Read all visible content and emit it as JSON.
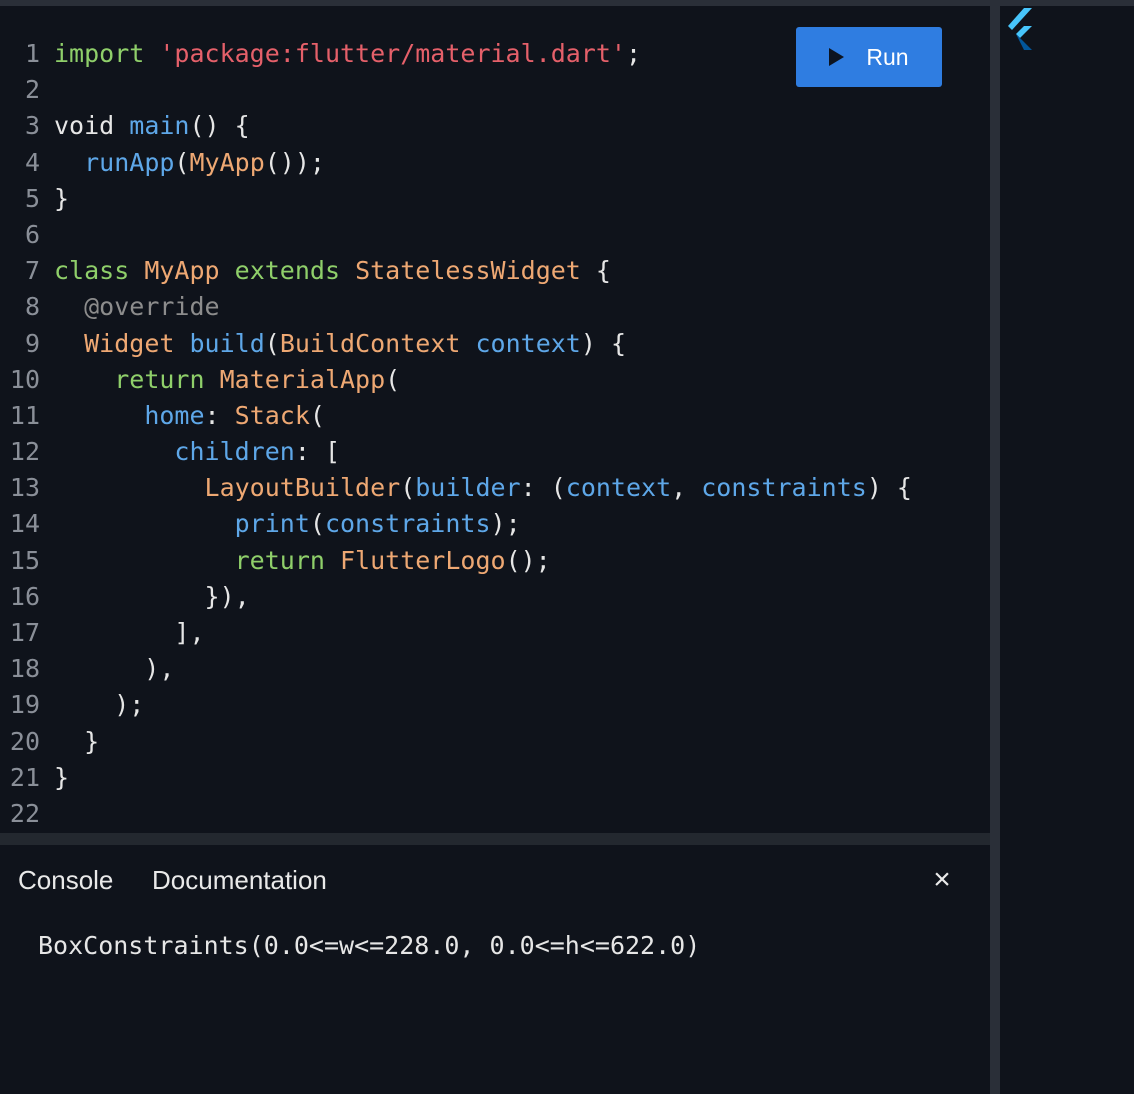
{
  "toolbar": {
    "run_label": "Run"
  },
  "icons": {
    "run": "play-icon",
    "close": "close-icon",
    "brand": "flutter-logo-icon"
  },
  "colors": {
    "keyword": "#8fcf6a",
    "string": "#e5606a",
    "function": "#5ea7e8",
    "type": "#eea873",
    "run_button": "#2f7de1",
    "background": "#0f131b"
  },
  "editor": {
    "lines": [
      [
        {
          "t": "import",
          "c": "kw"
        },
        {
          "t": " ",
          "c": "plain"
        },
        {
          "t": "'package:flutter/material.dart'",
          "c": "str"
        },
        {
          "t": ";",
          "c": "punc"
        }
      ],
      [],
      [
        {
          "t": "void ",
          "c": "plain"
        },
        {
          "t": "main",
          "c": "fn"
        },
        {
          "t": "() {",
          "c": "punc"
        }
      ],
      [
        {
          "t": "  ",
          "c": "plain"
        },
        {
          "t": "runApp",
          "c": "fn"
        },
        {
          "t": "(",
          "c": "punc"
        },
        {
          "t": "MyApp",
          "c": "type"
        },
        {
          "t": "());",
          "c": "punc"
        }
      ],
      [
        {
          "t": "}",
          "c": "punc"
        }
      ],
      [],
      [
        {
          "t": "class",
          "c": "kw"
        },
        {
          "t": " ",
          "c": "plain"
        },
        {
          "t": "MyApp",
          "c": "type"
        },
        {
          "t": " ",
          "c": "plain"
        },
        {
          "t": "extends",
          "c": "kw"
        },
        {
          "t": " ",
          "c": "plain"
        },
        {
          "t": "StatelessWidget",
          "c": "type"
        },
        {
          "t": " {",
          "c": "punc"
        }
      ],
      [
        {
          "t": "  ",
          "c": "plain"
        },
        {
          "t": "@override",
          "c": "ann"
        }
      ],
      [
        {
          "t": "  ",
          "c": "plain"
        },
        {
          "t": "Widget",
          "c": "type"
        },
        {
          "t": " ",
          "c": "plain"
        },
        {
          "t": "build",
          "c": "fn"
        },
        {
          "t": "(",
          "c": "punc"
        },
        {
          "t": "BuildContext",
          "c": "type"
        },
        {
          "t": " ",
          "c": "plain"
        },
        {
          "t": "context",
          "c": "fn"
        },
        {
          "t": ") {",
          "c": "punc"
        }
      ],
      [
        {
          "t": "    ",
          "c": "plain"
        },
        {
          "t": "return",
          "c": "kw"
        },
        {
          "t": " ",
          "c": "plain"
        },
        {
          "t": "MaterialApp",
          "c": "type"
        },
        {
          "t": "(",
          "c": "punc"
        }
      ],
      [
        {
          "t": "      ",
          "c": "plain"
        },
        {
          "t": "home",
          "c": "fn"
        },
        {
          "t": ": ",
          "c": "punc"
        },
        {
          "t": "Stack",
          "c": "type"
        },
        {
          "t": "(",
          "c": "punc"
        }
      ],
      [
        {
          "t": "        ",
          "c": "plain"
        },
        {
          "t": "children",
          "c": "fn"
        },
        {
          "t": ": [",
          "c": "punc"
        }
      ],
      [
        {
          "t": "          ",
          "c": "plain"
        },
        {
          "t": "LayoutBuilder",
          "c": "type"
        },
        {
          "t": "(",
          "c": "punc"
        },
        {
          "t": "builder",
          "c": "fn"
        },
        {
          "t": ": (",
          "c": "punc"
        },
        {
          "t": "context",
          "c": "fn"
        },
        {
          "t": ", ",
          "c": "punc"
        },
        {
          "t": "constraints",
          "c": "fn"
        },
        {
          "t": ") {",
          "c": "punc"
        }
      ],
      [
        {
          "t": "            ",
          "c": "plain"
        },
        {
          "t": "print",
          "c": "fn"
        },
        {
          "t": "(",
          "c": "punc"
        },
        {
          "t": "constraints",
          "c": "fn"
        },
        {
          "t": ");",
          "c": "punc"
        }
      ],
      [
        {
          "t": "            ",
          "c": "plain"
        },
        {
          "t": "return",
          "c": "kw"
        },
        {
          "t": " ",
          "c": "plain"
        },
        {
          "t": "FlutterLogo",
          "c": "type"
        },
        {
          "t": "();",
          "c": "punc"
        }
      ],
      [
        {
          "t": "          }),",
          "c": "punc"
        }
      ],
      [
        {
          "t": "        ],",
          "c": "punc"
        }
      ],
      [
        {
          "t": "      ),",
          "c": "punc"
        }
      ],
      [
        {
          "t": "    );",
          "c": "punc"
        }
      ],
      [
        {
          "t": "  }",
          "c": "punc"
        }
      ],
      [
        {
          "t": "}",
          "c": "punc"
        }
      ],
      []
    ]
  },
  "console": {
    "tabs": {
      "console": "Console",
      "documentation": "Documentation"
    },
    "close_label": "×",
    "output": "BoxConstraints(0.0<=w<=228.0, 0.0<=h<=622.0)"
  }
}
